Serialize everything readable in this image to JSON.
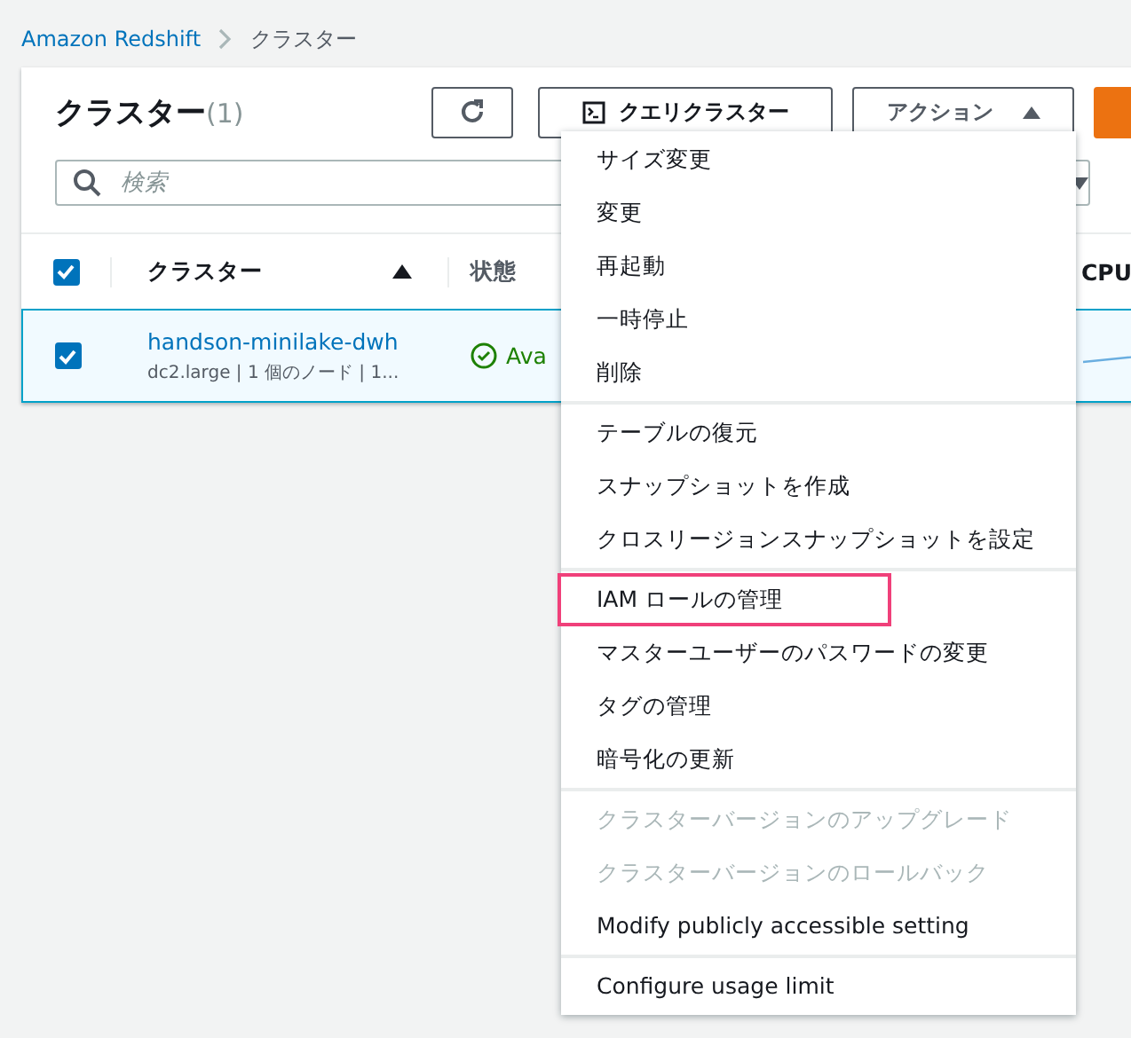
{
  "breadcrumb": [
    {
      "label": "Amazon Redshift"
    },
    {
      "label": "クラスター"
    }
  ],
  "panel": {
    "title": "クラスター",
    "count": "(1)",
    "buttons": [
      {
        "kind": "refresh"
      },
      {
        "kind": "query",
        "label": "クエリクラスター"
      },
      {
        "kind": "actions",
        "label": "アクション",
        "expanded": true
      },
      {
        "kind": "primary"
      }
    ],
    "search": {
      "placeholder": "検索"
    }
  },
  "table": {
    "all_checked": true,
    "columns": [
      {
        "label": "クラスター",
        "sorted": true
      },
      {
        "label": "状態",
        "sorted": false
      },
      {
        "label": "CPU"
      }
    ],
    "rows": [
      {
        "selected": true,
        "checked": true,
        "name": "handson-minilake-dwh",
        "detail": "dc2.large | 1 個のノード | 1...",
        "status": "Ava"
      }
    ]
  },
  "menu": {
    "groups": [
      [
        {
          "label": "サイズ変更",
          "disabled": false,
          "highlighted": false
        },
        {
          "label": "変更",
          "disabled": false,
          "highlighted": false
        },
        {
          "label": "再起動",
          "disabled": false,
          "highlighted": false
        },
        {
          "label": "一時停止",
          "disabled": false,
          "highlighted": false
        },
        {
          "label": "削除",
          "disabled": false,
          "highlighted": false
        }
      ],
      [
        {
          "label": "テーブルの復元",
          "disabled": false,
          "highlighted": false
        },
        {
          "label": "スナップショットを作成",
          "disabled": false,
          "highlighted": false
        },
        {
          "label": "クロスリージョンスナップショットを設定",
          "disabled": false,
          "highlighted": false
        }
      ],
      [
        {
          "label": "IAM ロールの管理",
          "disabled": false,
          "highlighted": true
        },
        {
          "label": "マスターユーザーのパスワードの変更",
          "disabled": false,
          "highlighted": false
        },
        {
          "label": "タグの管理",
          "disabled": false,
          "highlighted": false
        },
        {
          "label": "暗号化の更新",
          "disabled": false,
          "highlighted": false
        }
      ],
      [
        {
          "label": "クラスターバージョンのアップグレード",
          "disabled": true,
          "highlighted": false
        },
        {
          "label": "クラスターバージョンのロールバック",
          "disabled": true,
          "highlighted": false
        },
        {
          "label": "Modify publicly accessible setting",
          "disabled": false,
          "highlighted": false
        }
      ],
      [
        {
          "label": "Configure usage limit",
          "disabled": false,
          "highlighted": false
        }
      ]
    ]
  }
}
